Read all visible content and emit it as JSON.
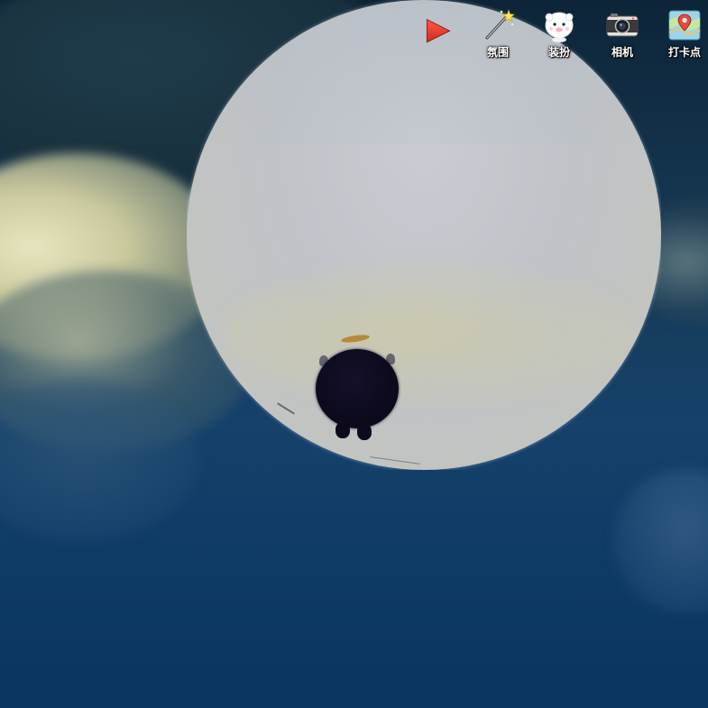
{
  "toolbar": {
    "play_icon": "red-play-triangle-icon",
    "items": [
      {
        "label": "氛围",
        "icon": "magic-wand-icon"
      },
      {
        "label": "装扮",
        "icon": "sheep-face-icon"
      },
      {
        "label": "相机",
        "icon": "camera-icon"
      },
      {
        "label": "打卡点",
        "icon": "map-pin-icon"
      }
    ]
  },
  "scene": {
    "colors": {
      "sky_top": "#0d2438",
      "sky_bottom": "#0a3560",
      "moon": "#c2c5ca",
      "character": "#0c0a1c",
      "halo": "#b68a3a",
      "play_button": "#e53a2f"
    }
  }
}
